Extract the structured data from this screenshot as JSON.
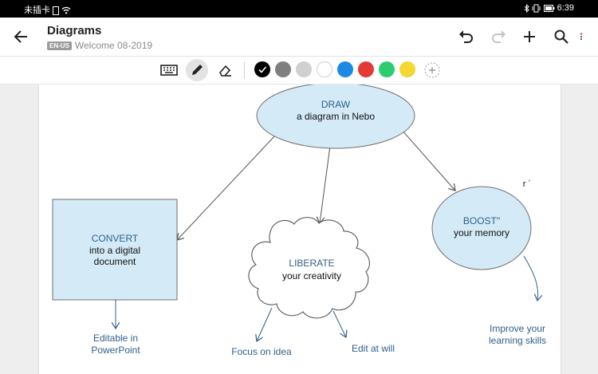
{
  "status_bar": {
    "carrier": "未插卡",
    "time": "6:39"
  },
  "app_bar": {
    "title": "Diagrams",
    "language_badge": "EN-US",
    "subtitle": "Welcome 08-2019",
    "icons": [
      "back-arrow-icon",
      "undo-icon",
      "redo-icon",
      "add-icon",
      "search-icon",
      "more-icon"
    ]
  },
  "toolbar": {
    "tools": [
      "keyboard-icon",
      "pen-icon",
      "eraser-icon"
    ],
    "active_tool": "pen",
    "colors": [
      "#000000",
      "#7f7f7f",
      "#d0d0d0",
      "#ffffff",
      "#1e88e5",
      "#e53935",
      "#2ecc71",
      "#f5d732"
    ],
    "selected_color": "#000000"
  },
  "diagram": {
    "draw": {
      "title": "DRAW",
      "subtitle": "a diagram in Nebo"
    },
    "convert": {
      "title": "CONVERT",
      "line2": "into a digital",
      "line3": "document"
    },
    "liberate": {
      "title": "LIBERATE",
      "subtitle": "your creativity"
    },
    "boost": {
      "title": "BOOST\"",
      "subtitle": "your memory"
    },
    "notes": {
      "editable_1": "Editable in",
      "editable_2": "PowerPoint",
      "focus": "Focus on idea",
      "edit": "Edit at will",
      "improve_1": "Improve your",
      "improve_2": "learning skills"
    },
    "stray_mark": "r ´"
  }
}
